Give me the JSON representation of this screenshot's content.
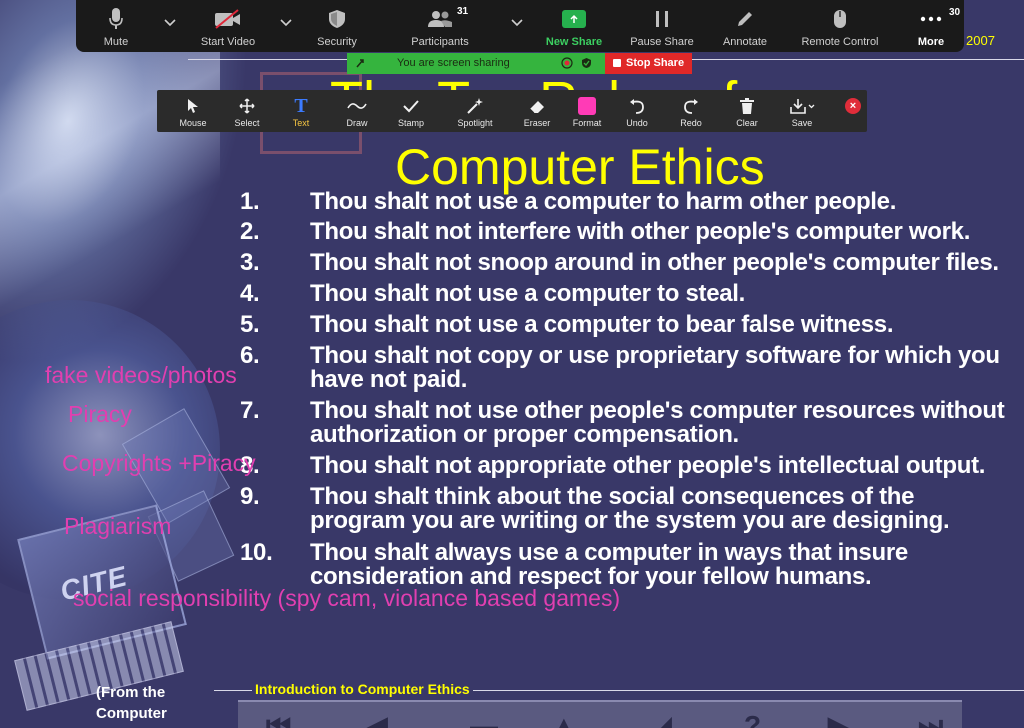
{
  "meeting_controls": {
    "mute": "Mute",
    "start_video": "Start Video",
    "security": "Security",
    "participants": "Participants",
    "participants_count": "31",
    "new_share": "New Share",
    "pause_share": "Pause Share",
    "annotate": "Annotate",
    "remote_control": "Remote Control",
    "more": "More",
    "more_badge": "30"
  },
  "share_status": {
    "sharing_text": "You are screen sharing",
    "stop_share": "Stop Share"
  },
  "annotation_toolbar": [
    {
      "label": "Mouse",
      "icon": "cursor-icon"
    },
    {
      "label": "Select",
      "icon": "move-icon"
    },
    {
      "label": "Text",
      "icon": "text-icon"
    },
    {
      "label": "Draw",
      "icon": "draw-icon"
    },
    {
      "label": "Stamp",
      "icon": "check-icon"
    },
    {
      "label": "Spotlight",
      "icon": "spotlight-icon"
    },
    {
      "label": "Eraser",
      "icon": "eraser-icon"
    },
    {
      "label": "Format",
      "icon": "format-icon"
    },
    {
      "label": "Undo",
      "icon": "undo-icon"
    },
    {
      "label": "Redo",
      "icon": "redo-icon"
    },
    {
      "label": "Clear",
      "icon": "trash-icon"
    },
    {
      "label": "Save",
      "icon": "save-icon"
    }
  ],
  "colors": {
    "title": "#ffff00",
    "annotation": "#e13fb0",
    "format_swatch": "#ff3bb6",
    "new_share": "#26b04e",
    "stop_share": "#e02828"
  },
  "slide": {
    "year": "2007",
    "title_line1": "The Ten Rules of",
    "title_line2": "Computer Ethics",
    "rules": [
      {
        "num": "1.",
        "text": "Thou shalt not use a computer to harm other people."
      },
      {
        "num": "2.",
        "text": "Thou shalt not interfere with other people's computer work."
      },
      {
        "num": "3.",
        "text": "Thou shalt not snoop around in other people's computer files."
      },
      {
        "num": "4.",
        "text": "Thou shalt not use a computer to steal."
      },
      {
        "num": "5.",
        "text": "Thou shalt not use a computer to bear false witness."
      },
      {
        "num": "6.",
        "text": "Thou shalt not copy or use proprietary software for which you have not paid."
      },
      {
        "num": "7.",
        "text": "Thou shalt not use other people's computer resources without authorization or proper compensation."
      },
      {
        "num": "8.",
        "text": "Thou shalt not appropriate other people's intellectual output."
      },
      {
        "num": "9.",
        "text": "Thou shalt think about the social consequences of the program you are writing or the system you are designing."
      },
      {
        "num": "10.",
        "text": "Thou shalt always use a computer in ways that insure consideration and respect for your fellow humans."
      }
    ],
    "source_note": "(From the Computer Ethics",
    "logo": "CITE",
    "footer_label": "Introduction to Computer Ethics"
  },
  "annotations": {
    "a1": "fake videos/photos",
    "a2": "Piracy",
    "a3": "Copyrights +Piracy",
    "a4": "Plagiarism",
    "a5": "social responsibility (spy cam, violance based games)"
  }
}
